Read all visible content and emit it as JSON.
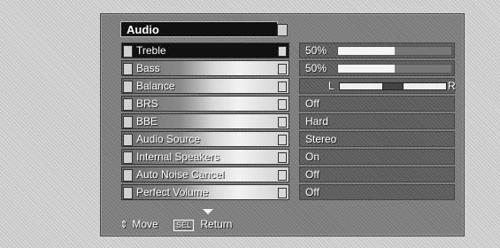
{
  "menu": {
    "title": "Audio",
    "items": [
      {
        "label": "Treble",
        "selected": true
      },
      {
        "label": "Bass"
      },
      {
        "label": "Balance"
      },
      {
        "label": "BRS"
      },
      {
        "label": "BBE"
      },
      {
        "label": "Audio Source"
      },
      {
        "label": "Internal Speakers"
      },
      {
        "label": "Auto Noise Cancel"
      },
      {
        "label": "Perfect Volume"
      }
    ]
  },
  "values": {
    "treble": {
      "text": "50%",
      "level": 0.5
    },
    "bass": {
      "text": "50%",
      "level": 0.5
    },
    "balance": {
      "left": "L",
      "right": "R",
      "position": 0.5
    },
    "brs": "Off",
    "bbe": "Hard",
    "audio_source": "Stereo",
    "internal_speakers": "On",
    "auto_noise_cancel": "Off",
    "perfect_volume": "Off"
  },
  "footer": {
    "move_label": "Move",
    "sel_key": "SEL",
    "return_label": "Return"
  }
}
